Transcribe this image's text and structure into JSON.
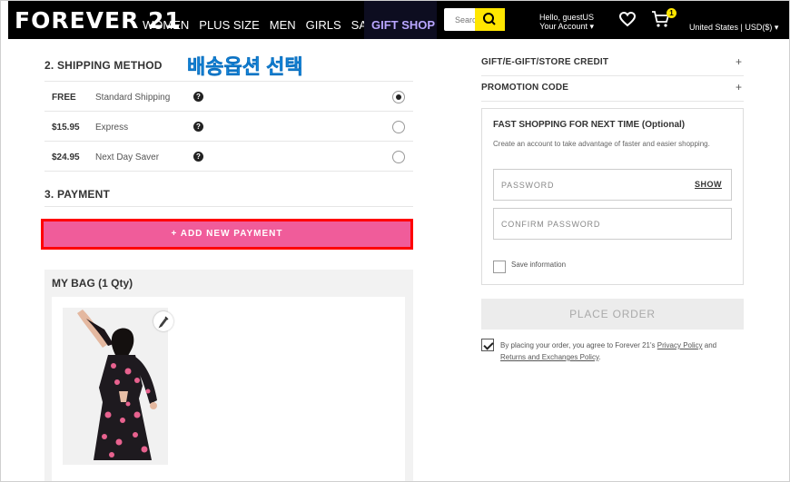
{
  "header": {
    "logo": "FOREVER 21",
    "nav": [
      "WOMEN",
      "PLUS SIZE",
      "MEN",
      "GIRLS",
      "SALE"
    ],
    "gift_shop": "GIFT SHOP",
    "search_placeholder": "Search",
    "greeting": "Hello, guestUS",
    "account": "Your Account",
    "cart_count": "1",
    "region": "United States | USD($)",
    "colors": {
      "bar": "#000000",
      "gift_shop_bg": "#0d0d20",
      "search_button": "#ffe600"
    }
  },
  "annotation": "배송옵션 선택",
  "shipping": {
    "title": "2. SHIPPING METHOD",
    "options": [
      {
        "price": "FREE",
        "name": "Standard Shipping",
        "selected": true
      },
      {
        "price": "$15.95",
        "name": "Express",
        "selected": false
      },
      {
        "price": "$24.95",
        "name": "Next Day Saver",
        "selected": false
      }
    ]
  },
  "payment": {
    "title": "3. PAYMENT",
    "add_button": "+ ADD NEW PAYMENT",
    "button_color": "#f05c9a"
  },
  "bag": {
    "title": "MY BAG (1 Qty)"
  },
  "right": {
    "gift_credit": "GIFT/E-GIFT/STORE CREDIT",
    "promo": "PROMOTION CODE",
    "plus": "+",
    "fast_title": "FAST SHOPPING FOR NEXT TIME (Optional)",
    "fast_desc": "Create an account to take advantage of faster and easier shopping.",
    "password_placeholder": "PASSWORD",
    "show": "SHOW",
    "confirm_placeholder": "CONFIRM PASSWORD",
    "save_info": "Save information",
    "place_order": "PLACE ORDER",
    "agree_prefix": "By placing your order, you agree to Forever 21's",
    "privacy": "Privacy Policy",
    "and": "and",
    "returns": "Returns and Exchanges Policy",
    "period": "."
  }
}
